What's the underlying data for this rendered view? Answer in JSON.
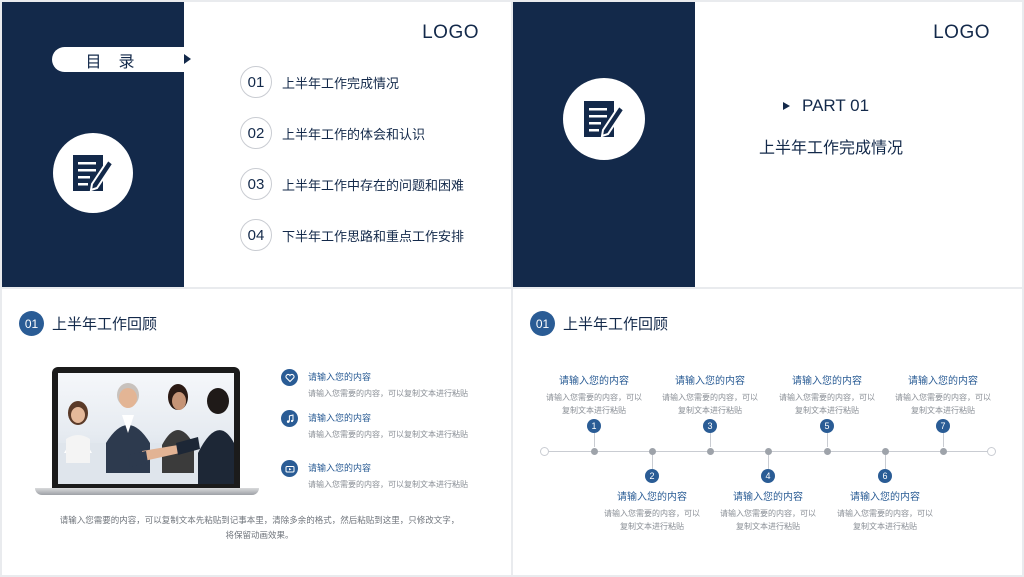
{
  "slide1": {
    "logo": "LOGO",
    "toc_title": "目 录",
    "items": [
      {
        "num": "01",
        "label": "上半年工作完成情况"
      },
      {
        "num": "02",
        "label": "上半年工作的体会和认识"
      },
      {
        "num": "03",
        "label": "上半年工作中存在的问题和困难"
      },
      {
        "num": "04",
        "label": "下半年工作思路和重点工作安排"
      }
    ],
    "icon": "document-pen-icon"
  },
  "slide2": {
    "logo": "LOGO",
    "part": "PART 01",
    "subtitle": "上半年工作完成情况",
    "icon": "document-pen-icon"
  },
  "slide3": {
    "badge": "01",
    "title": "上半年工作回顾",
    "features": [
      {
        "icon": "heart-icon",
        "title": "请输入您的内容",
        "desc": "请输入您需要的内容，可以复制文本进行粘贴"
      },
      {
        "icon": "music-note-icon",
        "title": "请输入您的内容",
        "desc": "请输入您需要的内容，可以复制文本进行粘贴"
      },
      {
        "icon": "video-icon",
        "title": "请输入您的内容",
        "desc": "请输入您需要的内容，可以复制文本进行粘贴"
      }
    ],
    "body_line1": "请输入您需要的内容，可以复制文本先粘贴到记事本里，清除多余的格式，然后粘贴到这里，只修改文字，",
    "body_line2": "将保留动画效果。"
  },
  "slide4": {
    "badge": "01",
    "title": "上半年工作回顾",
    "steps": [
      {
        "num": "1",
        "title": "请输入您的内容",
        "desc1": "请输入您需要的内容，可以",
        "desc2": "复制文本进行粘贴"
      },
      {
        "num": "2",
        "title": "请输入您的内容",
        "desc1": "请输入您需要的内容，可以",
        "desc2": "复制文本进行粘贴"
      },
      {
        "num": "3",
        "title": "请输入您的内容",
        "desc1": "请输入您需要的内容，可以",
        "desc2": "复制文本进行粘贴"
      },
      {
        "num": "4",
        "title": "请输入您的内容",
        "desc1": "请输入您需要的内容，可以",
        "desc2": "复制文本进行粘贴"
      },
      {
        "num": "5",
        "title": "请输入您的内容",
        "desc1": "请输入您需要的内容，可以",
        "desc2": "复制文本进行粘贴"
      },
      {
        "num": "6",
        "title": "请输入您的内容",
        "desc1": "请输入您需要的内容，可以",
        "desc2": "复制文本进行粘贴"
      },
      {
        "num": "7",
        "title": "请输入您的内容",
        "desc1": "请输入您需要的内容，可以",
        "desc2": "复制文本进行粘贴"
      }
    ]
  },
  "colors": {
    "navy": "#13294a",
    "accent": "#2a5c95"
  }
}
